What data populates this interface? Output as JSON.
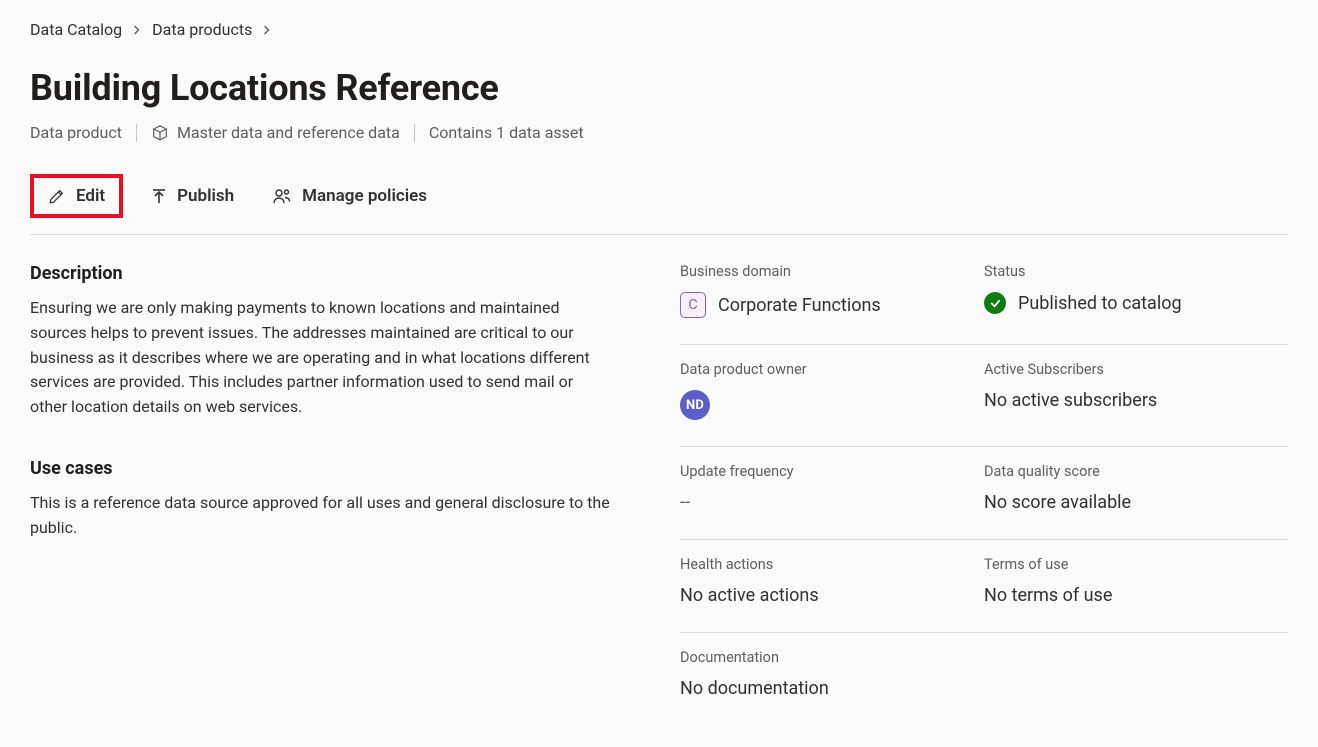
{
  "breadcrumb": {
    "root": "Data Catalog",
    "mid": "Data products"
  },
  "title": "Building Locations Reference",
  "subtitle": {
    "type": "Data product",
    "category": "Master data and reference data",
    "asset_count": "Contains 1 data asset"
  },
  "toolbar": {
    "edit": "Edit",
    "publish": "Publish",
    "manage_policies": "Manage policies"
  },
  "description": {
    "heading": "Description",
    "body": "Ensuring we are only making payments to known locations and maintained sources helps to prevent issues.  The addresses maintained are critical to our business as it describes where we are operating and in what locations different services are provided.  This includes partner information used to send mail or other location details on web services."
  },
  "use_cases": {
    "heading": "Use cases",
    "body": "This is a reference data source approved for all uses and general disclosure to the public."
  },
  "info": {
    "business_domain": {
      "label": "Business domain",
      "badge": "C",
      "value": "Corporate Functions"
    },
    "status": {
      "label": "Status",
      "value": "Published to catalog"
    },
    "owner": {
      "label": "Data product owner",
      "initials": "ND"
    },
    "subscribers": {
      "label": "Active Subscribers",
      "value": "No active subscribers"
    },
    "update_freq": {
      "label": "Update frequency",
      "value": "--"
    },
    "quality": {
      "label": "Data quality score",
      "value": "No score available"
    },
    "health": {
      "label": "Health actions",
      "value": "No active actions"
    },
    "terms": {
      "label": "Terms of use",
      "value": "No terms of use"
    },
    "docs": {
      "label": "Documentation",
      "value": "No documentation"
    }
  }
}
